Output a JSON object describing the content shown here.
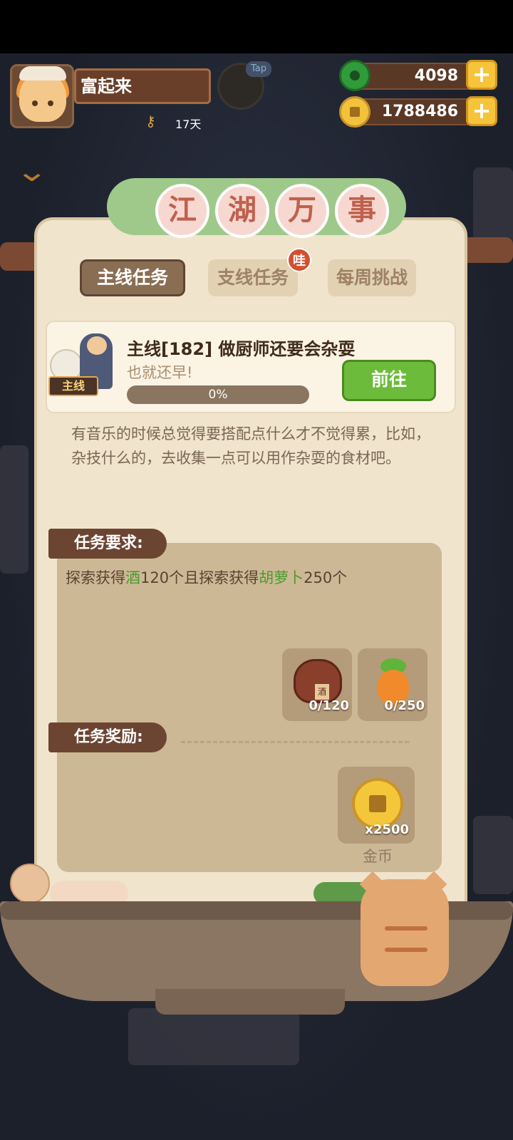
{
  "player": {
    "name": "富起来",
    "days": "17天",
    "tap_label": "Tap"
  },
  "currency": {
    "jade": "4098",
    "coins": "1788486",
    "plus": "+"
  },
  "panel": {
    "title_chars": [
      "江",
      "湖",
      "万",
      "事"
    ],
    "tabs": {
      "main": "主线任务",
      "side": "支线任务",
      "weekly": "每周挑战"
    },
    "side_badge": "哇"
  },
  "quest": {
    "tag": "主线",
    "title": "主线[182] 做厨师还要会杂耍",
    "subtitle": "也就还早!",
    "progress_text": "0%",
    "progress_value": 0,
    "go_label": "前往",
    "story": "有音乐的时候总觉得要搭配点什么才不觉得累，比如，杂技什么的，去收集一点可以用作杂耍的食材吧。"
  },
  "requirements": {
    "header": "任务要求:",
    "text_parts": [
      "探索获得",
      "酒",
      "120个且探索获得",
      "胡萝卜",
      "250个"
    ],
    "items": [
      {
        "icon": "wine-jar-icon",
        "label": "酒",
        "count": "0/120"
      },
      {
        "icon": "carrot-icon",
        "label": "",
        "count": "0/250"
      }
    ]
  },
  "rewards": {
    "header": "任务奖励:",
    "items": [
      {
        "icon": "gold-coin-icon",
        "count": "x2500",
        "name": "金币"
      }
    ]
  },
  "colors": {
    "highlight_green": "#4d9a2d",
    "go_button": "#6dbb3a",
    "panel_bg": "#f0e4cd",
    "header_brown": "#6b4532"
  }
}
